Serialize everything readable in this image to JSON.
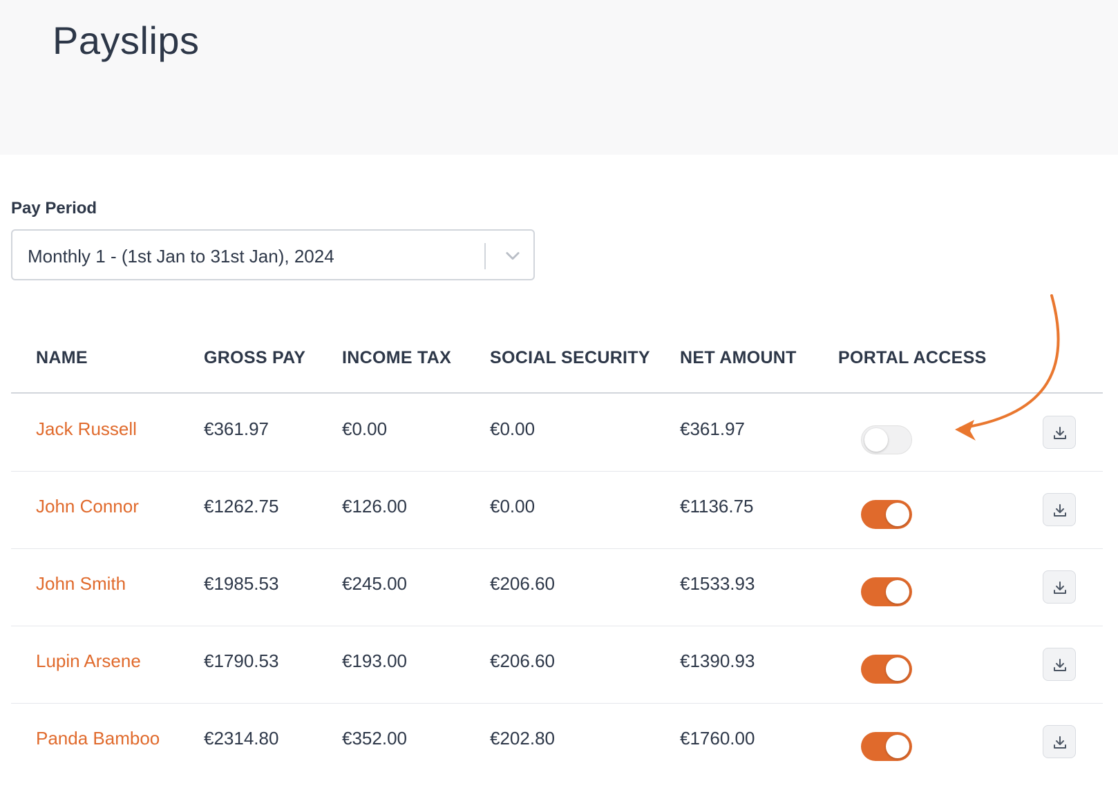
{
  "header": {
    "title": "Payslips"
  },
  "pay_period": {
    "label": "Pay Period",
    "selected": "Monthly 1 - (1st Jan to 31st Jan), 2024"
  },
  "table": {
    "columns": [
      "NAME",
      "GROSS PAY",
      "INCOME TAX",
      "SOCIAL SECURITY",
      "NET AMOUNT",
      "PORTAL ACCESS"
    ],
    "rows": [
      {
        "name": "Jack Russell",
        "gross": "€361.97",
        "tax": "€0.00",
        "social": "€0.00",
        "net": "€361.97",
        "portal_access": false
      },
      {
        "name": "John Connor",
        "gross": "€1262.75",
        "tax": "€126.00",
        "social": "€0.00",
        "net": "€1136.75",
        "portal_access": true
      },
      {
        "name": "John Smith",
        "gross": "€1985.53",
        "tax": "€245.00",
        "social": "€206.60",
        "net": "€1533.93",
        "portal_access": true
      },
      {
        "name": "Lupin Arsene",
        "gross": "€1790.53",
        "tax": "€193.00",
        "social": "€206.60",
        "net": "€1390.93",
        "portal_access": true
      },
      {
        "name": "Panda Bamboo",
        "gross": "€2314.80",
        "tax": "€352.00",
        "social": "€202.80",
        "net": "€1760.00",
        "portal_access": true
      }
    ]
  },
  "icons": {
    "select": "chevron-down-icon",
    "row_action": "download-icon",
    "annotation": "curved-arrow-icon"
  },
  "colors": {
    "accent": "#e06a2c",
    "header_bg": "#f8f8f9",
    "text": "#2d3748"
  }
}
